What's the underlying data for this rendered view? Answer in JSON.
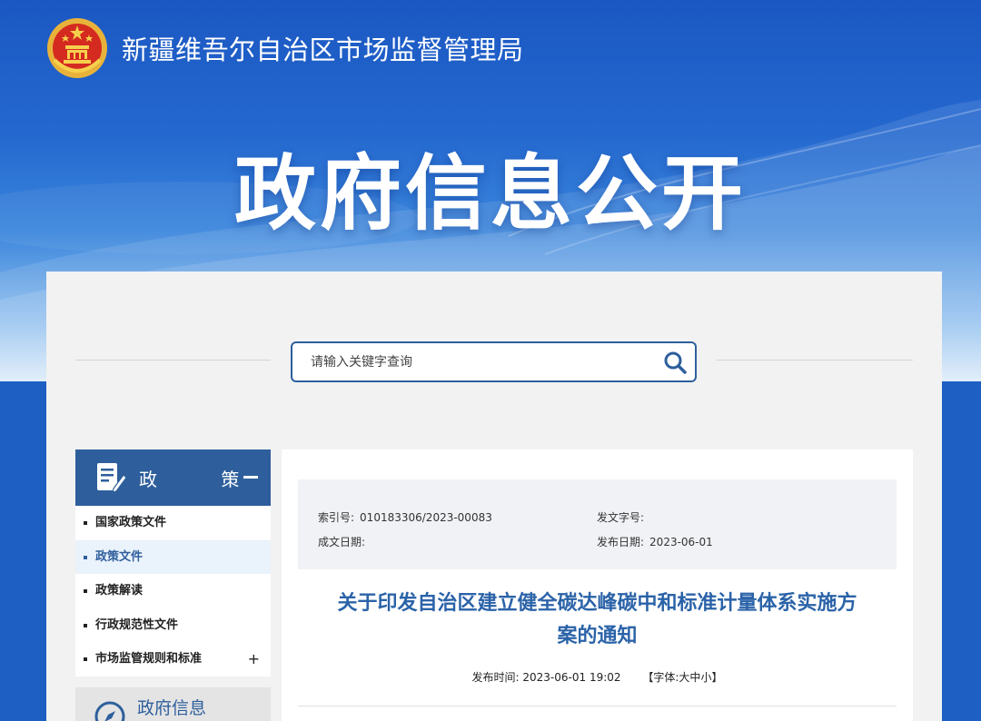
{
  "header": {
    "site_title": "新疆维吾尔自治区市场监督管理局",
    "hero_title": "政府信息公开"
  },
  "search": {
    "placeholder": "请输入关键字查询"
  },
  "sidebar": {
    "section_title": "政 策",
    "items": [
      {
        "label": "国家政策文件"
      },
      {
        "label": "政策文件"
      },
      {
        "label": "政策解读"
      },
      {
        "label": "行政规范性文件"
      },
      {
        "label": "市场监管规则和标准"
      }
    ],
    "expand_symbol": "+",
    "next_section_title": "政府信息"
  },
  "meta": {
    "index_label": "索引号:",
    "index_value": "010183306/2023-00083",
    "doc_no_label": "发文字号:",
    "doc_no_value": "",
    "written_date_label": "成文日期:",
    "written_date_value": "",
    "publish_date_label": "发布日期:",
    "publish_date_value": "2023-06-01"
  },
  "article": {
    "title_line1": "关于印发自治区建立健全碳达峰碳中和标准计量体系实施方",
    "title_line2": "案的通知",
    "publish_time_label": "发布时间:",
    "publish_time_value": "2023-06-01 19:02",
    "font_size_prefix": "【字体:",
    "font_size_large": "大",
    "font_size_medium": "中",
    "font_size_small": "小",
    "font_size_suffix": "】"
  },
  "colors": {
    "brand_blue": "#2e5f9c",
    "title_blue": "#2b63a8",
    "active_bg": "#eaf2fb"
  }
}
